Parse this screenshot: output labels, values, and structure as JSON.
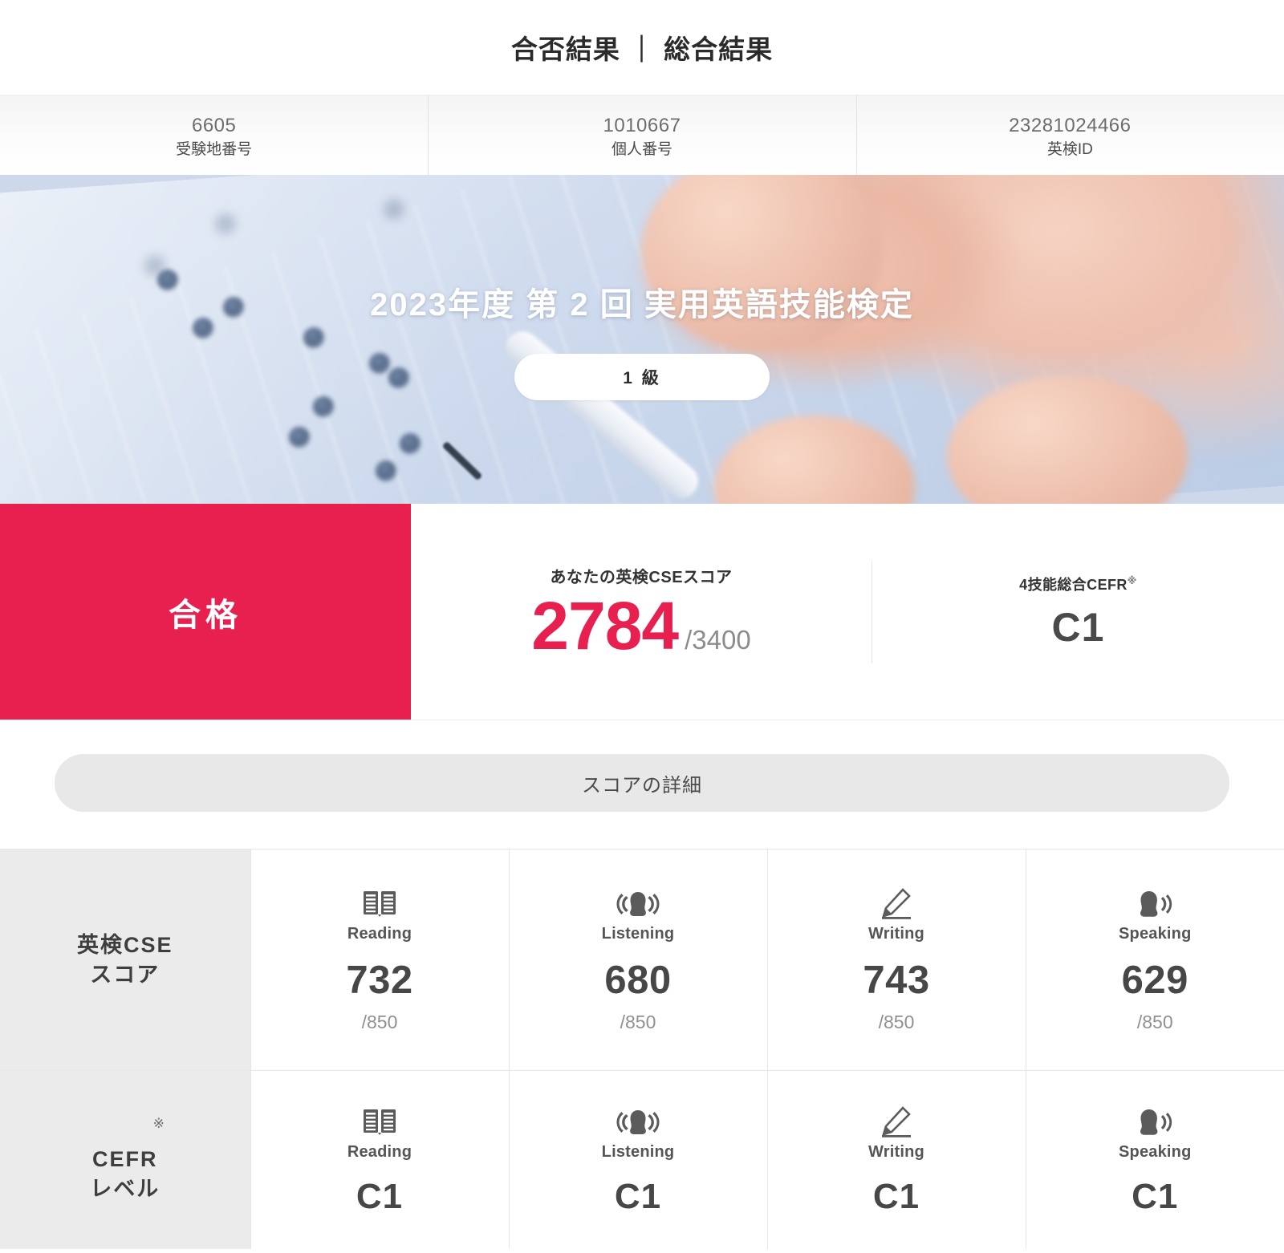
{
  "header": {
    "title": "合否結果 ｜ 総合結果"
  },
  "id_strip": [
    {
      "value": "6605",
      "label": "受験地番号",
      "name": "test-site-number"
    },
    {
      "value": "1010667",
      "label": "個人番号",
      "name": "personal-number"
    },
    {
      "value": "23281024466",
      "label": "英検ID",
      "name": "eiken-id"
    }
  ],
  "hero": {
    "title": "2023年度 第 2 回 実用英語技能検定",
    "grade_badge": "1 級"
  },
  "result": {
    "pass_label": "合格",
    "cse": {
      "label": "あなたの英検CSEスコア",
      "value": "2784",
      "max": "/3400"
    },
    "cefr": {
      "label": "4技能総合CEFR",
      "mark": "※",
      "value": "C1"
    }
  },
  "detail_button": {
    "label": "スコアの詳細"
  },
  "score_table": {
    "rows": [
      {
        "head": "英検CSE\nスコア",
        "head_line1": "英検CSE",
        "head_line2": "スコア",
        "mark": "",
        "cells": [
          {
            "icon": "book-icon",
            "skill": "Reading",
            "value": "732",
            "max": "/850"
          },
          {
            "icon": "listening-icon",
            "skill": "Listening",
            "value": "680",
            "max": "/850"
          },
          {
            "icon": "pencil-icon",
            "skill": "Writing",
            "value": "743",
            "max": "/850"
          },
          {
            "icon": "speaking-icon",
            "skill": "Speaking",
            "value": "629",
            "max": "/850"
          }
        ]
      },
      {
        "head_line1": "CEFR",
        "head_line2": "レベル",
        "mark": "※",
        "cells": [
          {
            "icon": "book-icon",
            "skill": "Reading",
            "value": "C1"
          },
          {
            "icon": "listening-icon",
            "skill": "Listening",
            "value": "C1"
          },
          {
            "icon": "pencil-icon",
            "skill": "Writing",
            "value": "C1"
          },
          {
            "icon": "speaking-icon",
            "skill": "Speaking",
            "value": "C1"
          }
        ]
      }
    ]
  },
  "colors": {
    "accent_red": "#e8204f",
    "head_grey": "#ebebeb",
    "button_grey": "#e8e8e8",
    "icon_grey": "#5b5b5b"
  }
}
